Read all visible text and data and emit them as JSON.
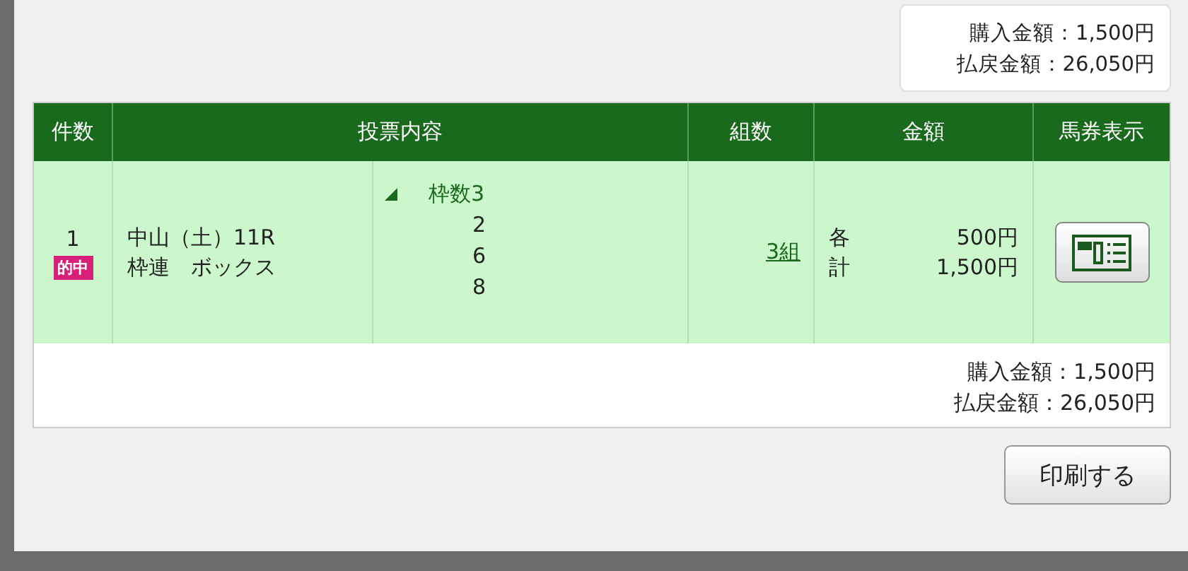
{
  "summary_top": {
    "purchase": "購入金額：1,500円",
    "payout": "払戻金額：26,050円"
  },
  "table": {
    "columns": [
      "件数",
      "投票内容",
      "組数",
      "金額",
      "馬券表示"
    ],
    "rows": [
      {
        "count": "1",
        "badge": "的中",
        "race": "中山（土）11R",
        "bet_type": "枠連　ボックス",
        "group": {
          "label": "枠数3",
          "expanded": true,
          "numbers": [
            "2",
            "6",
            "8"
          ]
        },
        "sets": "3組",
        "each_label": "各",
        "each_amount": "500円",
        "total_label": "計",
        "total_amount": "1,500円"
      }
    ],
    "footer": {
      "purchase": "購入金額：1,500円",
      "payout": "払戻金額：26,050円"
    }
  },
  "print_button": "印刷する"
}
